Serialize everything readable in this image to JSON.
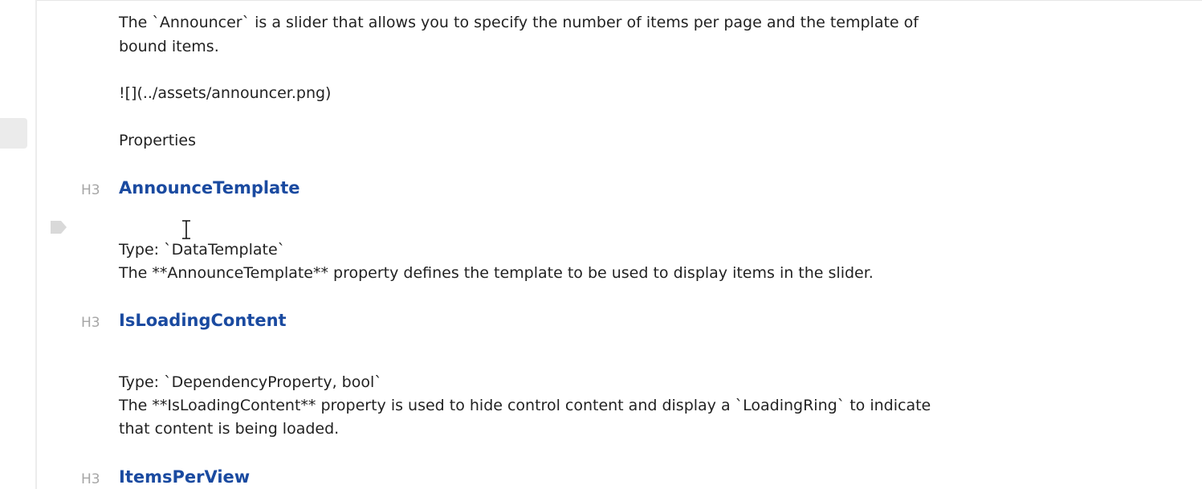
{
  "editor": {
    "intro_line1": "The `Announcer` is a slider that allows you to specify the number of items per page and the template of",
    "intro_line2": "bound items.",
    "image_line": "![](../assets/announcer.png)",
    "properties_label": "Properties",
    "sections": [
      {
        "tag": "H3",
        "heading": "AnnounceTemplate",
        "type_line": "Type: `DataTemplate`",
        "desc_line1": "The **AnnounceTemplate** property defines the template to be used to display items in the slider."
      },
      {
        "tag": "H3",
        "heading": "IsLoadingContent",
        "type_line": "Type: `DependencyProperty, bool`",
        "desc_line1": "The **IsLoadingContent** property is used to hide control content and display a `LoadingRing` to indicate",
        "desc_line2": "that content is being loaded."
      },
      {
        "tag": "H3",
        "heading": "ItemsPerView"
      }
    ]
  },
  "icons": {
    "block_handle": "block-handle-icon",
    "text_cursor": "text-cursor-icon"
  },
  "colors": {
    "heading": "#1a4aa0",
    "tag": "#a6a6a6",
    "text": "#222222"
  }
}
